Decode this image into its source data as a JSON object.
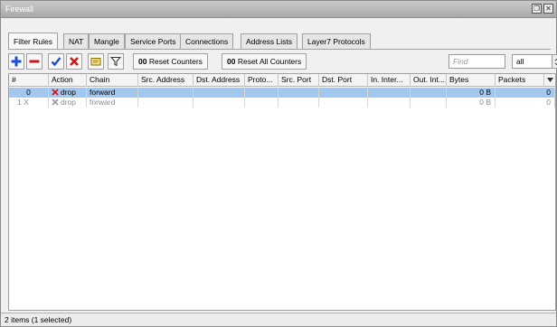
{
  "window": {
    "title": "Firewall",
    "restore_glyph": "❐",
    "close_glyph": "✕"
  },
  "tabs": [
    {
      "label": "Filter Rules",
      "active": true
    },
    {
      "label": "NAT"
    },
    {
      "label": "Mangle"
    },
    {
      "label": "Service Ports"
    },
    {
      "label": "Connections"
    },
    {
      "label": "Address Lists"
    },
    {
      "label": "Layer7 Protocols"
    }
  ],
  "toolbar": {
    "icons": [
      "add-icon",
      "remove-icon",
      "enable-icon",
      "disable-icon",
      "comment-icon",
      "filter-icon"
    ],
    "reset_counters_prefix": "00",
    "reset_counters_label": "Reset Counters",
    "reset_all_counters_prefix": "00",
    "reset_all_counters_label": "Reset All Counters",
    "find_placeholder": "Find",
    "filter_value": "all"
  },
  "table": {
    "columns": [
      "#",
      "Action",
      "Chain",
      "Src. Address",
      "Dst. Address",
      "Proto...",
      "Src. Port",
      "Dst. Port",
      "In. Inter...",
      "Out. Int...",
      "Bytes",
      "Packets"
    ],
    "rows": [
      {
        "num": "0",
        "flag": "",
        "action": "drop",
        "chain": "forward",
        "bytes": "0 B",
        "packets": "0",
        "selected": true,
        "disabled": false
      },
      {
        "num": "1",
        "flag": "X",
        "action": "drop",
        "chain": "forward",
        "bytes": "0 B",
        "packets": "0",
        "selected": false,
        "disabled": true
      }
    ]
  },
  "status": {
    "text": "2 items (1 selected)"
  },
  "colors": {
    "selection": "#a3c8f0",
    "add": "#1a4fd6",
    "remove": "#d01818",
    "enable": "#1a4fd6",
    "disable": "#d01818"
  }
}
